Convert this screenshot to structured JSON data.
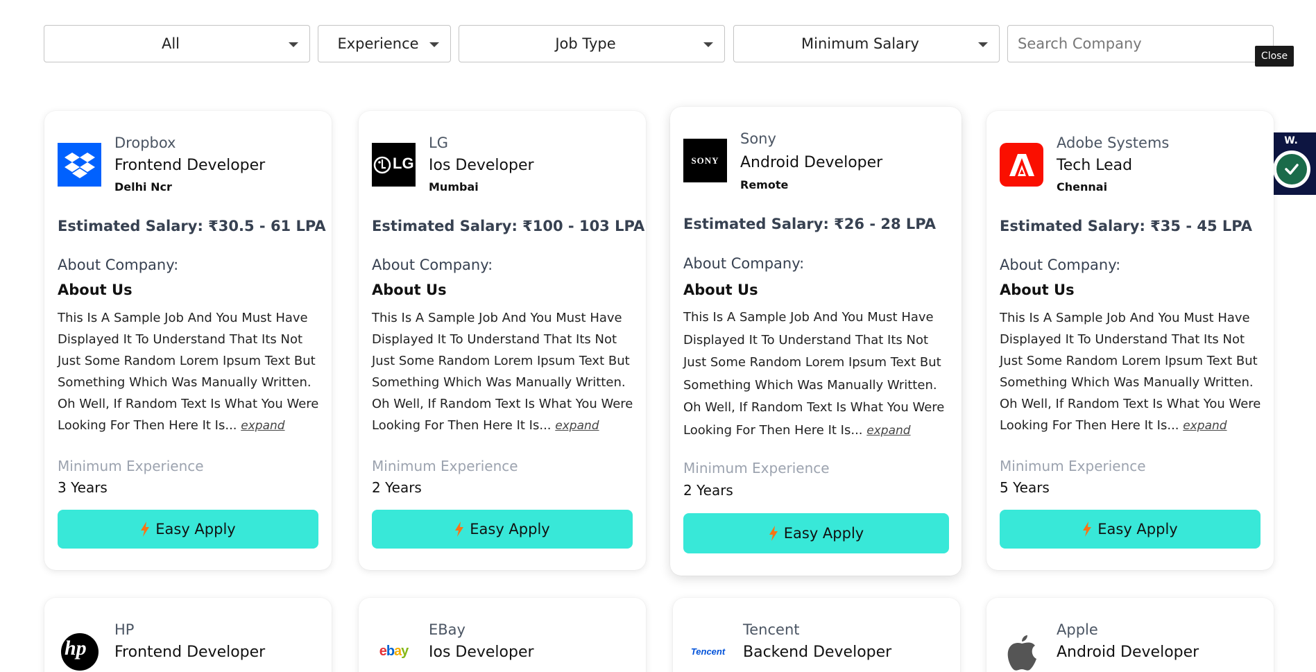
{
  "filters": {
    "category": "All",
    "experience": "Experience",
    "job_type": "Job Type",
    "min_salary": "Minimum Salary",
    "search_placeholder": "Search Company"
  },
  "close_label": "Close",
  "widget_label": "W.",
  "labels": {
    "about_company": "About Company:",
    "about_us": "About Us",
    "min_experience": "Minimum Experience",
    "easy_apply": "Easy Apply",
    "expand": "expand"
  },
  "description": "This Is A Sample Job And You Must Have Displayed It To Understand That Its Not Just Some Random Lorem Ipsum Text But Something Which Was Manually Written. Oh Well, If Random Text Is What You Were Looking For Then Here It Is...",
  "jobs": [
    {
      "company": "Dropbox",
      "role": "Frontend Developer",
      "location": "Delhi Ncr",
      "salary": "Estimated Salary: ₹30.5 - 61 LPA",
      "experience": "3 Years",
      "logo": "dropbox-logo"
    },
    {
      "company": "LG",
      "role": "Ios Developer",
      "location": "Mumbai",
      "salary": "Estimated Salary: ₹100 - 103 LPA",
      "experience": "2 Years",
      "logo": "lg-logo"
    },
    {
      "company": "Sony",
      "role": "Android Developer",
      "location": "Remote",
      "salary": "Estimated Salary: ₹26 - 28 LPA",
      "experience": "2 Years",
      "logo": "sony-logo"
    },
    {
      "company": "Adobe Systems",
      "role": "Tech Lead",
      "location": "Chennai",
      "salary": "Estimated Salary: ₹35 - 45 LPA",
      "experience": "5 Years",
      "logo": "adobe-logo"
    },
    {
      "company": "HP",
      "role": "Frontend Developer",
      "logo": "hp-logo"
    },
    {
      "company": "EBay",
      "role": "Ios Developer",
      "logo": "ebay-logo"
    },
    {
      "company": "Tencent",
      "role": "Backend Developer",
      "logo": "tencent-logo"
    },
    {
      "company": "Apple",
      "role": "Android Developer",
      "logo": "apple-logo"
    }
  ],
  "logo_text": {
    "lg": "LG",
    "sony": "SONY",
    "ebay_e": "e",
    "ebay_b": "b",
    "ebay_a": "a",
    "ebay_y": "y",
    "tencent": "Tencent",
    "hp": "hp"
  },
  "colors": {
    "apply_button": "#38e8d8",
    "bolt": "#f97316",
    "dropbox": "#0061fe",
    "adobe": "#fa0f00",
    "widget_bg": "#0d1541"
  }
}
